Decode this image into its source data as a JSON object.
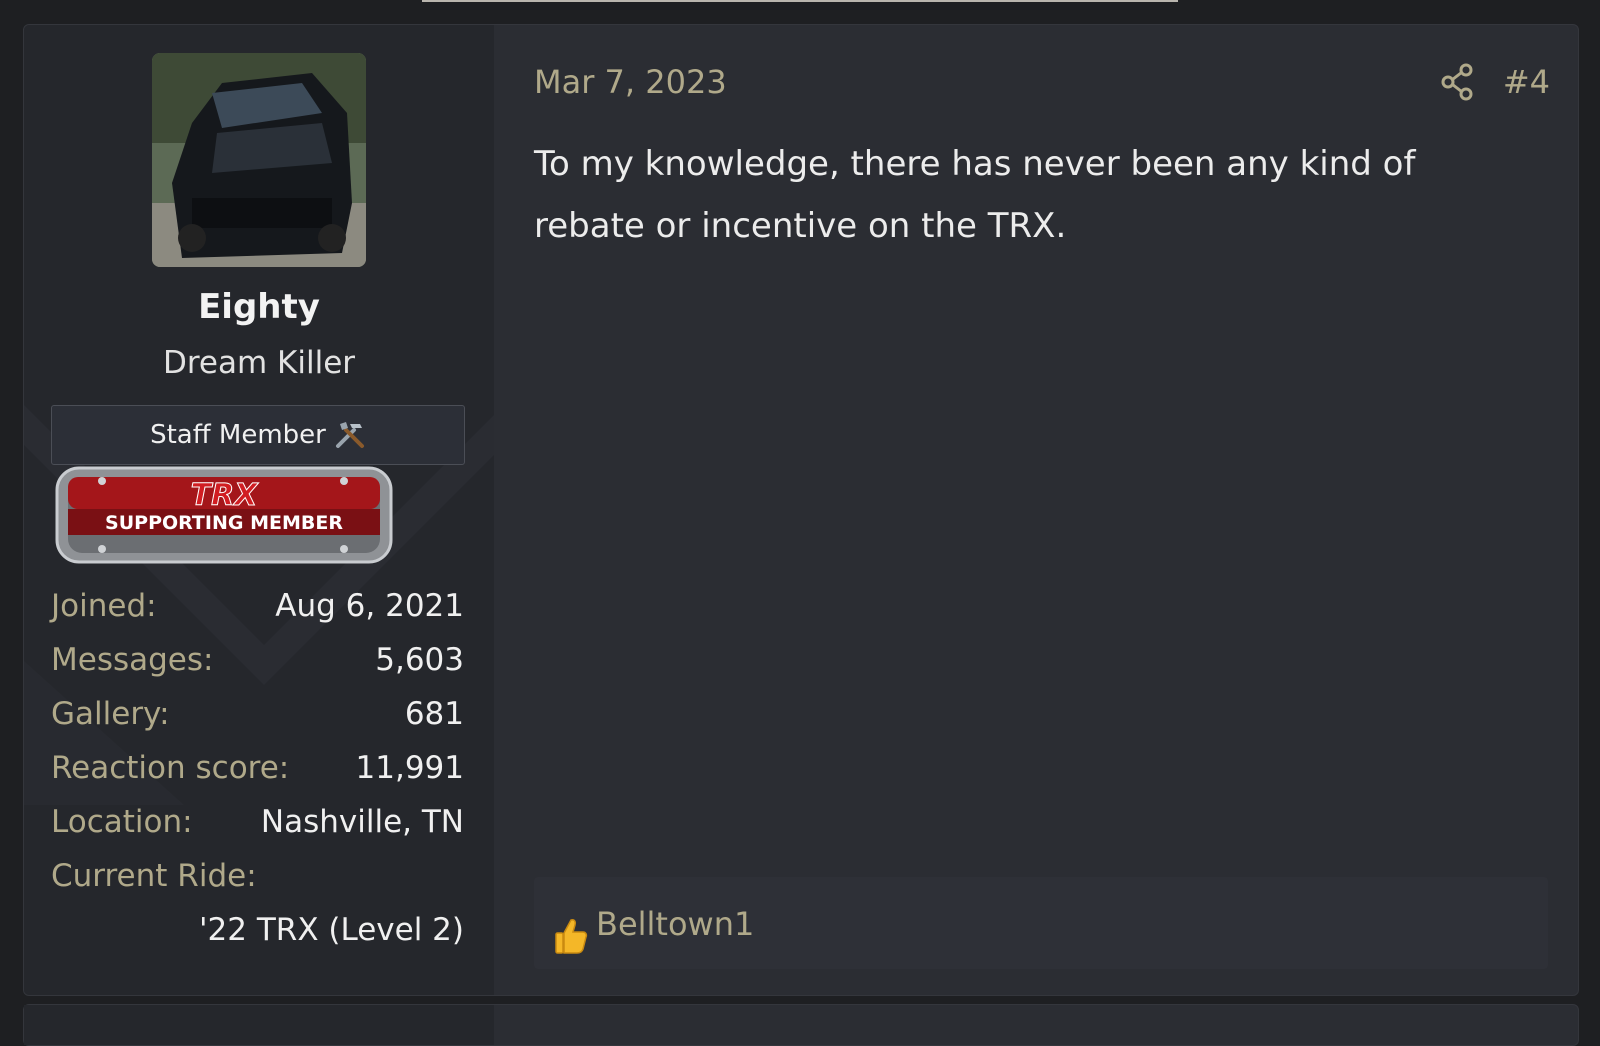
{
  "user": {
    "avatar_icon": "truck-avatar-photo",
    "name": "Eighty",
    "title": "Dream Killer",
    "staff_banner": "Staff Member",
    "staff_icon": "tools-icon",
    "badge_top_text": "TRX",
    "badge_text": "SUPPORTING MEMBER"
  },
  "stats": [
    {
      "label": "Joined:",
      "value": "Aug 6, 2021"
    },
    {
      "label": "Messages:",
      "value": "5,603"
    },
    {
      "label": "Gallery:",
      "value": "681"
    },
    {
      "label": "Reaction score:",
      "value": "11,991"
    },
    {
      "label": "Location:",
      "value": "Nashville, TN"
    },
    {
      "label": "Current Ride:",
      "value": ""
    }
  ],
  "current_ride_value": "'22 TRX (Level 2)",
  "post": {
    "date": "Mar 7, 2023",
    "number": "#4",
    "share_icon": "share-icon",
    "body": "To my knowledge, there has never been any kind of rebate or incentive on the TRX."
  },
  "reactions": {
    "icon": "thumbs-up-icon",
    "users": "Belltown1"
  },
  "colors": {
    "background": "#1e1f22",
    "panel": "#2b2d33",
    "user_panel": "#25272c",
    "muted_accent": "#b0a98a",
    "text": "#ececec"
  }
}
